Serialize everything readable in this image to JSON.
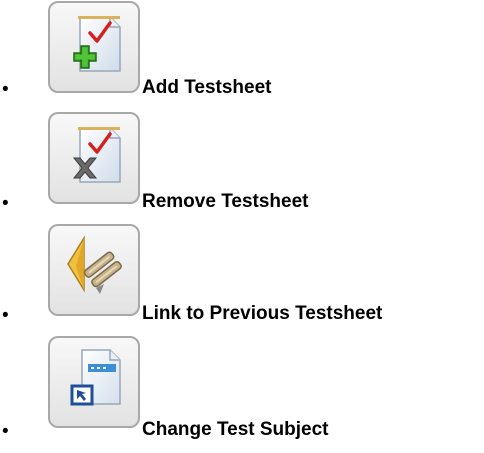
{
  "items": [
    {
      "label": "Add Testsheet",
      "icon": "add-testsheet-icon"
    },
    {
      "label": "Remove Testsheet",
      "icon": "remove-testsheet-icon"
    },
    {
      "label": "Link to Previous Testsheet",
      "icon": "link-previous-icon"
    },
    {
      "label": "Change Test Subject",
      "icon": "change-subject-icon"
    }
  ],
  "bullet": "•"
}
